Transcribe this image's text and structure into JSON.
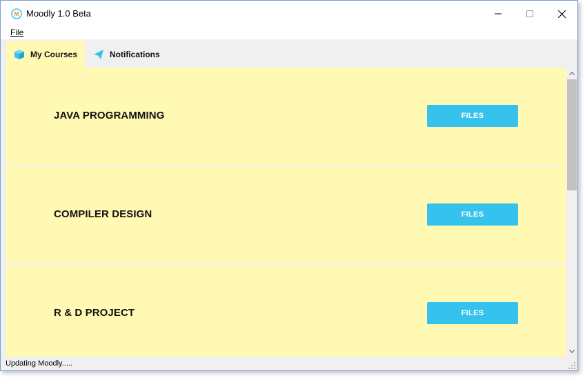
{
  "window": {
    "title": "Moodly 1.0 Beta",
    "controls": [
      "minimize",
      "maximize",
      "close"
    ]
  },
  "menu": {
    "file_label": "File"
  },
  "tabs": [
    {
      "label": "My Courses",
      "icon": "cube-icon",
      "active": true
    },
    {
      "label": "Notifications",
      "icon": "paper-plane-icon",
      "active": false
    }
  ],
  "courses": [
    {
      "name": "JAVA PROGRAMMING",
      "button_label": "FILES"
    },
    {
      "name": "COMPILER DESIGN",
      "button_label": "FILES"
    },
    {
      "name": "R & D PROJECT",
      "button_label": "FILES"
    }
  ],
  "status": {
    "text": "Updating Moodly....."
  },
  "colors": {
    "course_background": "#fff9b3",
    "files_button": "#35c2ed",
    "tab_icon": "#35c2ed"
  }
}
